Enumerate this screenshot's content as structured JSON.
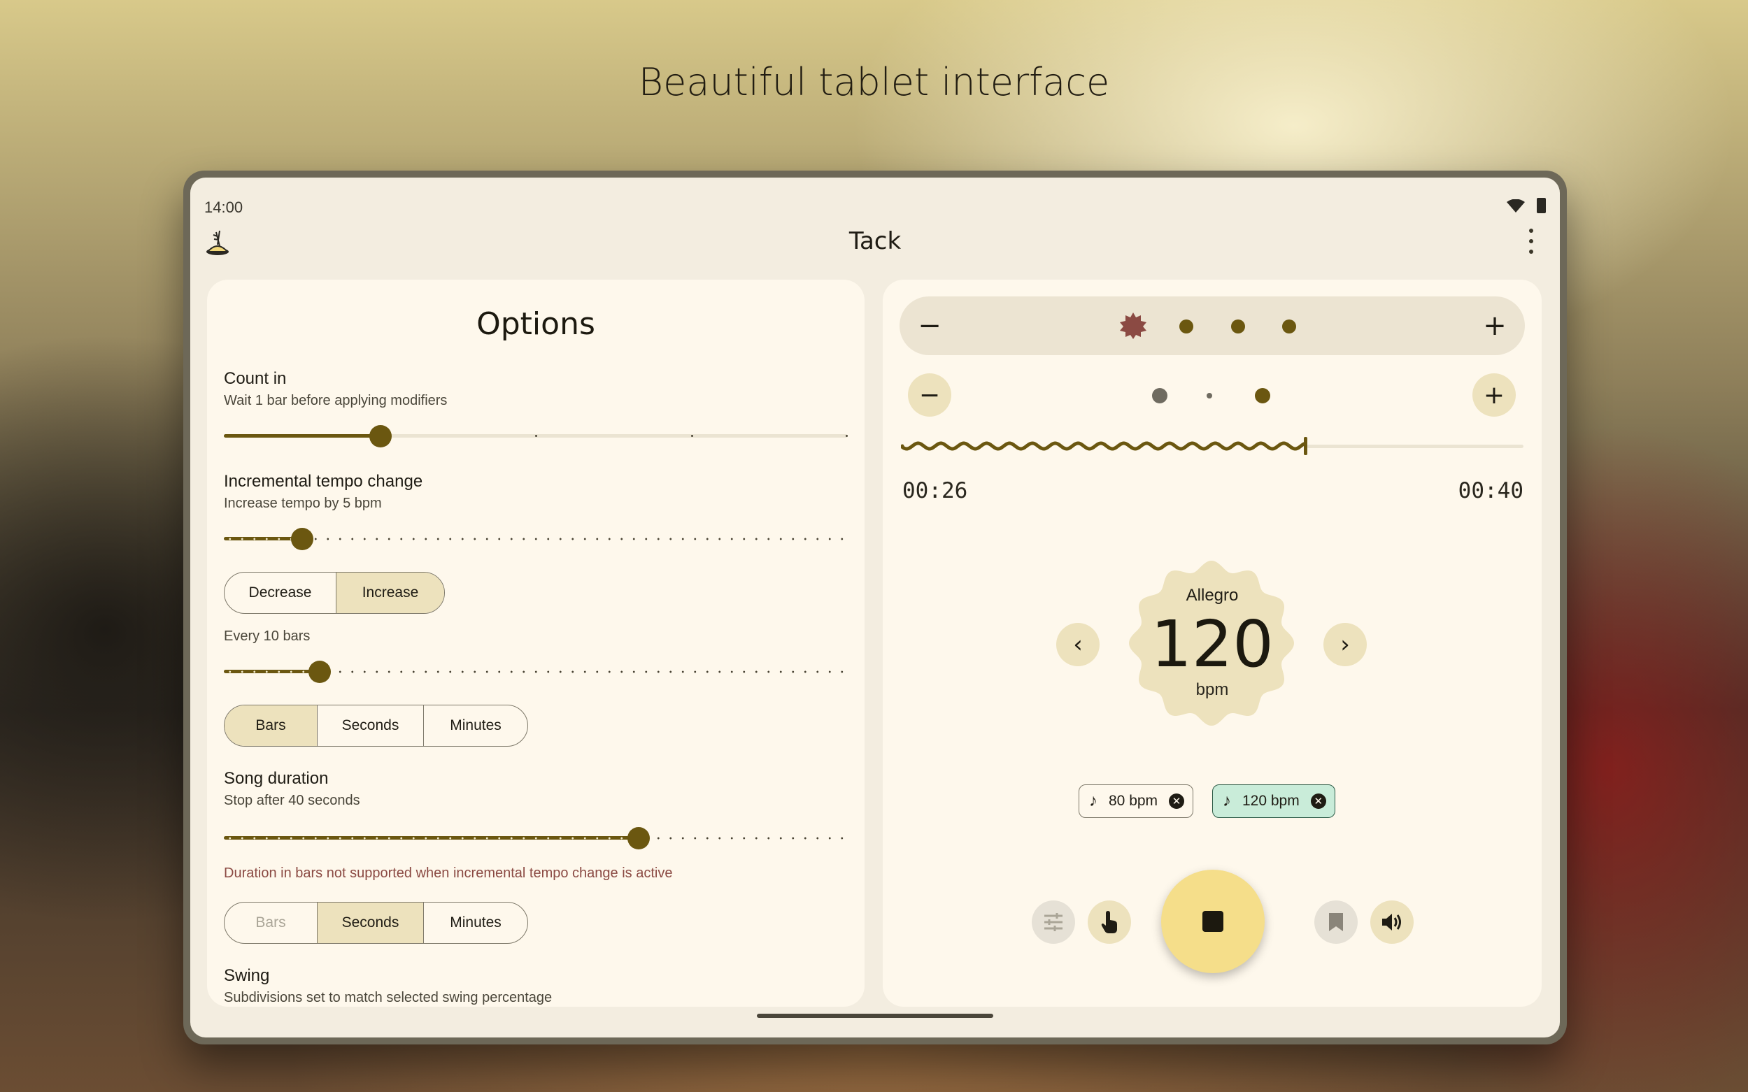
{
  "headline": "Beautiful tablet interface",
  "status": {
    "time": "14:00"
  },
  "appbar": {
    "title": "Tack"
  },
  "options": {
    "title": "Options",
    "count_in": {
      "title": "Count in",
      "subtitle": "Wait 1 bar before applying modifiers",
      "slider_fraction": 0.25
    },
    "incremental": {
      "title": "Incremental tempo change",
      "subtitle": "Increase tempo by 5 bpm",
      "slider_fraction": 0.125,
      "direction": [
        "Decrease",
        "Increase"
      ],
      "selected_direction": "Increase",
      "every_label": "Every 10 bars",
      "every_fraction": 0.155,
      "units": [
        "Bars",
        "Seconds",
        "Minutes"
      ],
      "selected_unit": "Bars"
    },
    "song_duration": {
      "title": "Song duration",
      "subtitle": "Stop after 40 seconds",
      "slider_fraction": 0.665,
      "warning": "Duration in bars not supported when incremental tempo change is active",
      "units": [
        "Bars",
        "Seconds",
        "Minutes"
      ],
      "selected_unit": "Seconds",
      "disabled_unit": "Bars"
    },
    "swing": {
      "title": "Swing",
      "subtitle": "Subdivisions set to match selected swing percentage"
    }
  },
  "player": {
    "beat_minus": "−",
    "beat_plus": "+",
    "sub_minus": "−",
    "sub_plus": "+",
    "progress_fraction": 0.65,
    "elapsed": "00:26",
    "total": "00:40",
    "tempo_name": "Allegro",
    "tempo": "120",
    "tempo_unit": "bpm",
    "prev": "‹",
    "next": "›",
    "bookmarks": [
      {
        "label": "80 bpm",
        "active": false
      },
      {
        "label": "120 bpm",
        "active": true
      }
    ],
    "colors": {
      "accent": "#6b5710",
      "play": "#f5de8a",
      "badge": "#ede2bd",
      "first_beat": "#8b4a43",
      "active_chip": "#c9ecd9"
    }
  }
}
